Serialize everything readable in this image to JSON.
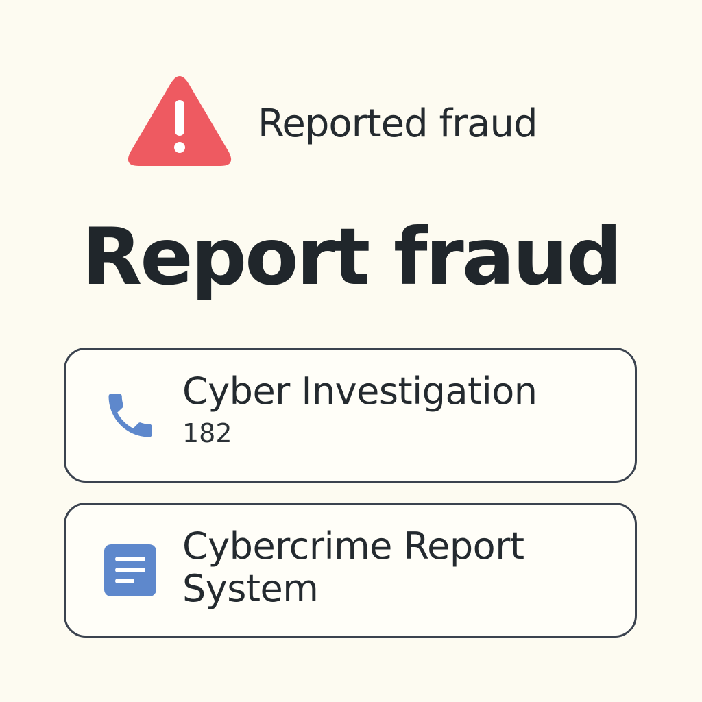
{
  "alert": {
    "icon": "warning-triangle-icon",
    "icon_color": "#ee5a61",
    "label": "Reported fraud"
  },
  "title": "Report fraud",
  "contacts": [
    {
      "icon": "phone-icon",
      "icon_color": "#5e88cc",
      "title": "Cyber Investigation",
      "number": "182"
    },
    {
      "icon": "document-icon",
      "icon_color": "#5e88cc",
      "title_line1": "Cybercrime Report",
      "title_line2": "System"
    }
  ]
}
